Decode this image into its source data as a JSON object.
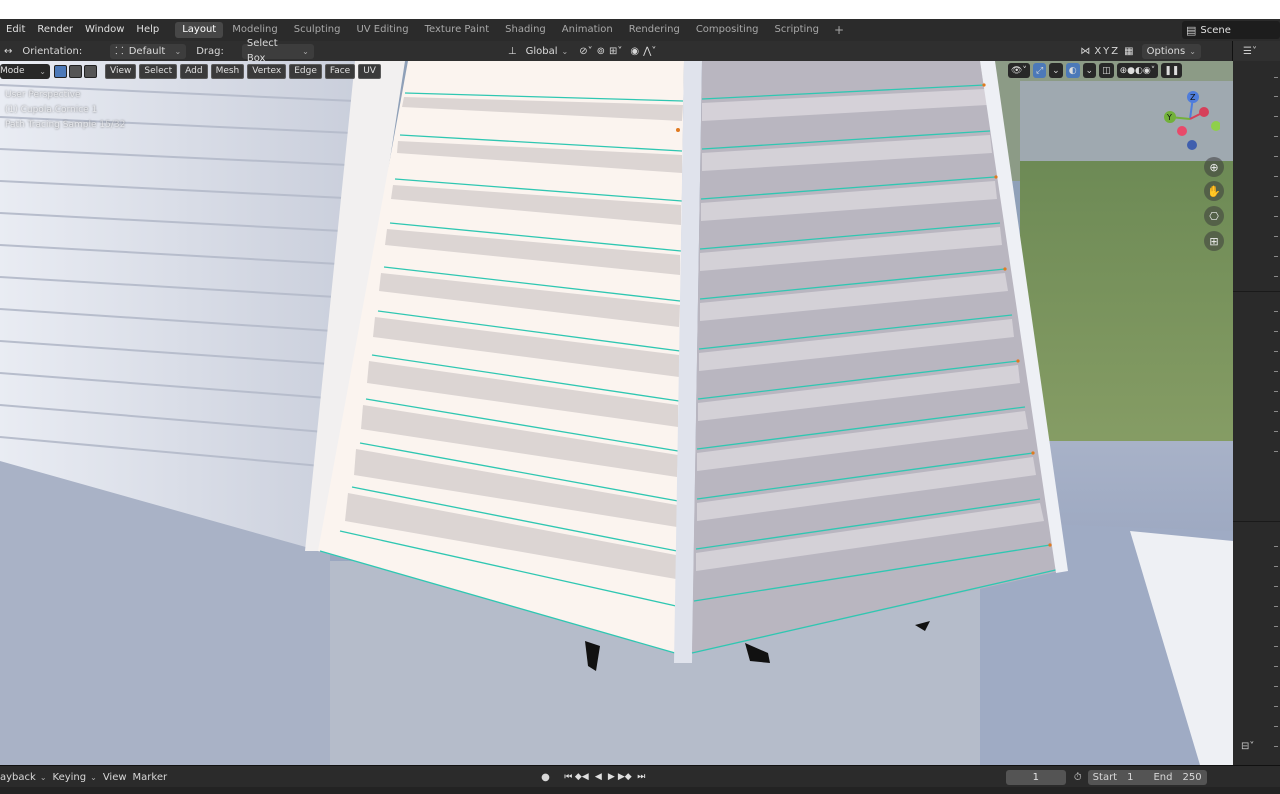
{
  "menubar": {
    "items": [
      "Edit",
      "Render",
      "Window",
      "Help"
    ],
    "tabs": [
      {
        "label": "Layout",
        "active": true
      },
      {
        "label": "Modeling"
      },
      {
        "label": "Sculpting"
      },
      {
        "label": "UV Editing"
      },
      {
        "label": "Texture Paint"
      },
      {
        "label": "Shading"
      },
      {
        "label": "Animation"
      },
      {
        "label": "Rendering"
      },
      {
        "label": "Compositing"
      },
      {
        "label": "Scripting"
      }
    ],
    "add_tab": "+",
    "scene": "Scene"
  },
  "toolbar": {
    "orientation_label": "Orientation:",
    "orientation_value": "Default",
    "drag_label": "Drag:",
    "drag_value": "Select Box",
    "transform_orientation": "Global",
    "axis_x": "X",
    "axis_y": "Y",
    "axis_z": "Z",
    "options": "Options"
  },
  "viewport": {
    "mode": "Mode",
    "menus": [
      "View",
      "Select",
      "Add",
      "Mesh",
      "Vertex",
      "Edge",
      "Face",
      "UV"
    ],
    "overlay_lines": [
      "User Perspective",
      "(1) Cupola.Cornice 1",
      "Path Tracing Sample 15/32"
    ],
    "gizmo_labels": {
      "z": "Z",
      "y": "Y"
    }
  },
  "timeline": {
    "playback": "ayback",
    "keying": "Keying",
    "view": "View",
    "marker": "Marker",
    "current_frame": "1",
    "start_label": "Start",
    "start_value": "1",
    "end_label": "End",
    "end_value": "250"
  },
  "colors": {
    "accent": "#4c79b8",
    "edge_select": "#2fc7b2",
    "vertex": "#e07a20",
    "header_bg": "#2b2b2b"
  }
}
